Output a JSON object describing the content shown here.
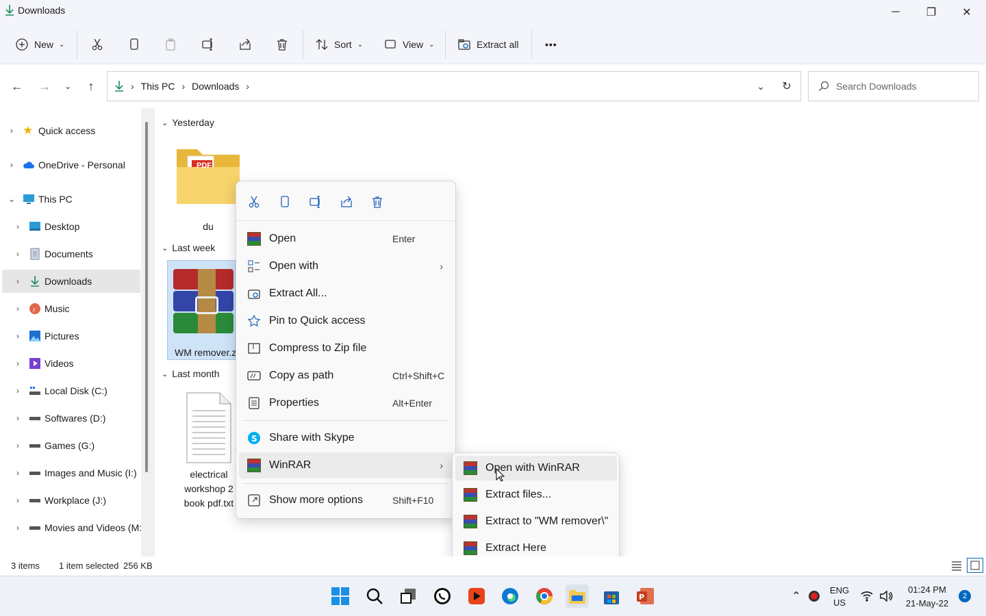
{
  "window": {
    "title": "Downloads",
    "minimize": "─",
    "restore": "❐",
    "close": "✕"
  },
  "toolbar": {
    "new_label": "New",
    "sort_label": "Sort",
    "view_label": "View",
    "extract_all_label": "Extract all",
    "more_label": "•••"
  },
  "address": {
    "crumbs": [
      "This PC",
      "Downloads"
    ],
    "search_placeholder": "Search Downloads"
  },
  "sidebar": {
    "items": [
      {
        "label": "Quick access",
        "icon": "star-icon"
      },
      {
        "label": "OneDrive - Personal",
        "icon": "cloud-icon"
      },
      {
        "label": "This PC",
        "icon": "computer-icon"
      },
      {
        "label": "Desktop",
        "icon": "desktop-icon"
      },
      {
        "label": "Documents",
        "icon": "documents-icon"
      },
      {
        "label": "Downloads",
        "icon": "download-icon"
      },
      {
        "label": "Music",
        "icon": "music-icon"
      },
      {
        "label": "Pictures",
        "icon": "pictures-icon"
      },
      {
        "label": "Videos",
        "icon": "videos-icon"
      },
      {
        "label": "Local Disk (C:)",
        "icon": "drive-icon"
      },
      {
        "label": "Softwares (D:)",
        "icon": "drive-icon"
      },
      {
        "label": "Games (G:)",
        "icon": "drive-icon"
      },
      {
        "label": "Images and Music (I:)",
        "icon": "drive-icon"
      },
      {
        "label": "Workplace (J:)",
        "icon": "drive-icon"
      },
      {
        "label": "Movies and Videos (M:)",
        "icon": "drive-icon"
      }
    ]
  },
  "groups": {
    "yesterday": "Yesterday",
    "last_week": "Last week",
    "last_month": "Last month"
  },
  "files": {
    "folder_du": {
      "name": "du",
      "badge": "PDF"
    },
    "wm_remover": {
      "name": "WM remover.z"
    },
    "electrical": {
      "line1": "electrical",
      "line2": "workshop 2",
      "line3": "book pdf.txt"
    }
  },
  "context_menu": {
    "items": [
      {
        "label": "Open",
        "shortcut": "Enter"
      },
      {
        "label": "Open with",
        "shortcut": ""
      },
      {
        "label": "Extract All...",
        "shortcut": ""
      },
      {
        "label": "Pin to Quick access",
        "shortcut": ""
      },
      {
        "label": "Compress to Zip file",
        "shortcut": ""
      },
      {
        "label": "Copy as path",
        "shortcut": "Ctrl+Shift+C"
      },
      {
        "label": "Properties",
        "shortcut": "Alt+Enter"
      },
      {
        "label": "Share with Skype",
        "shortcut": ""
      },
      {
        "label": "WinRAR",
        "shortcut": ""
      },
      {
        "label": "Show more options",
        "shortcut": "Shift+F10"
      }
    ]
  },
  "winrar_submenu": {
    "items": [
      {
        "label": "Open with WinRAR"
      },
      {
        "label": "Extract files..."
      },
      {
        "label": "Extract to \"WM remover\\\""
      },
      {
        "label": "Extract Here"
      }
    ]
  },
  "status": {
    "items_count": "3 items",
    "selection": "1 item selected",
    "size": "256 KB"
  },
  "taskbar": {
    "lang": "ENG",
    "region": "US",
    "time": "01:24 PM",
    "date": "21-May-22",
    "notifications": "2"
  },
  "colors": {
    "accent": "#0067c0",
    "folder": "#f2c94c",
    "selected_bg": "#e6e6e6"
  }
}
